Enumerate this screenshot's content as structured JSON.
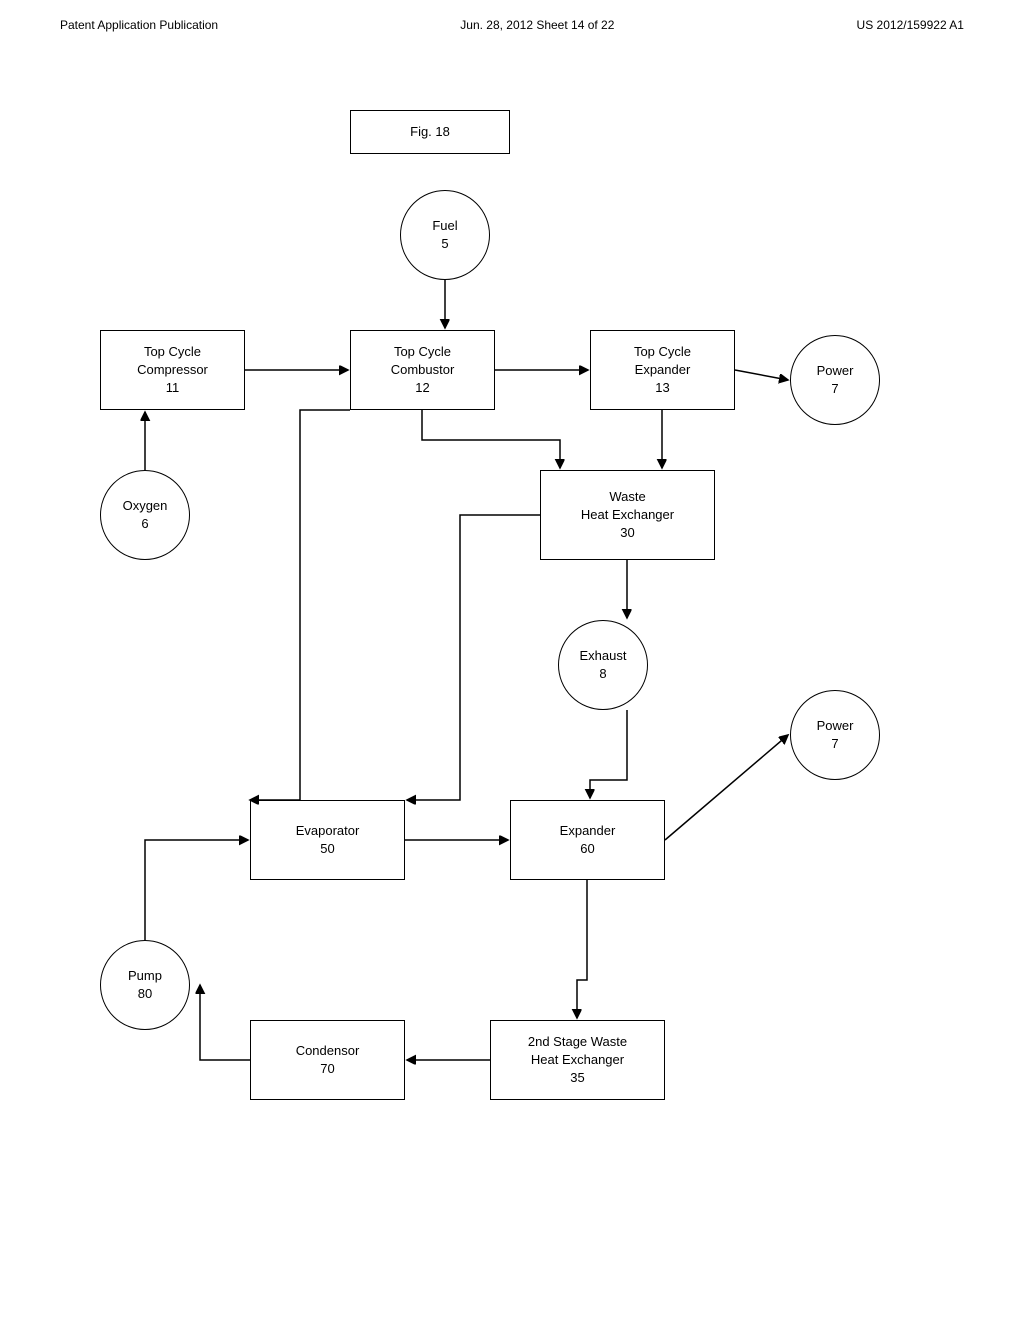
{
  "header": {
    "left": "Patent Application Publication",
    "center": "Jun. 28, 2012  Sheet 14 of 22",
    "right": "US 2012/159922 A1"
  },
  "figure_label": "Fig. 18",
  "nodes": {
    "fuel": {
      "label": "Fuel\n5"
    },
    "top_cycle_compressor": {
      "label": "Top Cycle\nCompressor\n11"
    },
    "top_cycle_combustor": {
      "label": "Top Cycle\nCombustor\n12"
    },
    "top_cycle_expander": {
      "label": "Top Cycle\nExpander\n13"
    },
    "power_top": {
      "label": "Power\n7"
    },
    "oxygen": {
      "label": "Oxygen\n6"
    },
    "waste_heat_exchanger": {
      "label": "Waste\nHeat Exchanger\n30"
    },
    "exhaust": {
      "label": "Exhaust\n8"
    },
    "power_bottom": {
      "label": "Power\n7"
    },
    "evaporator": {
      "label": "Evaporator\n50"
    },
    "expander": {
      "label": "Expander\n60"
    },
    "pump": {
      "label": "Pump\n80"
    },
    "condensor": {
      "label": "Condensor\n70"
    },
    "second_stage_waste": {
      "label": "2nd Stage Waste\nHeat Exchanger\n35"
    }
  }
}
